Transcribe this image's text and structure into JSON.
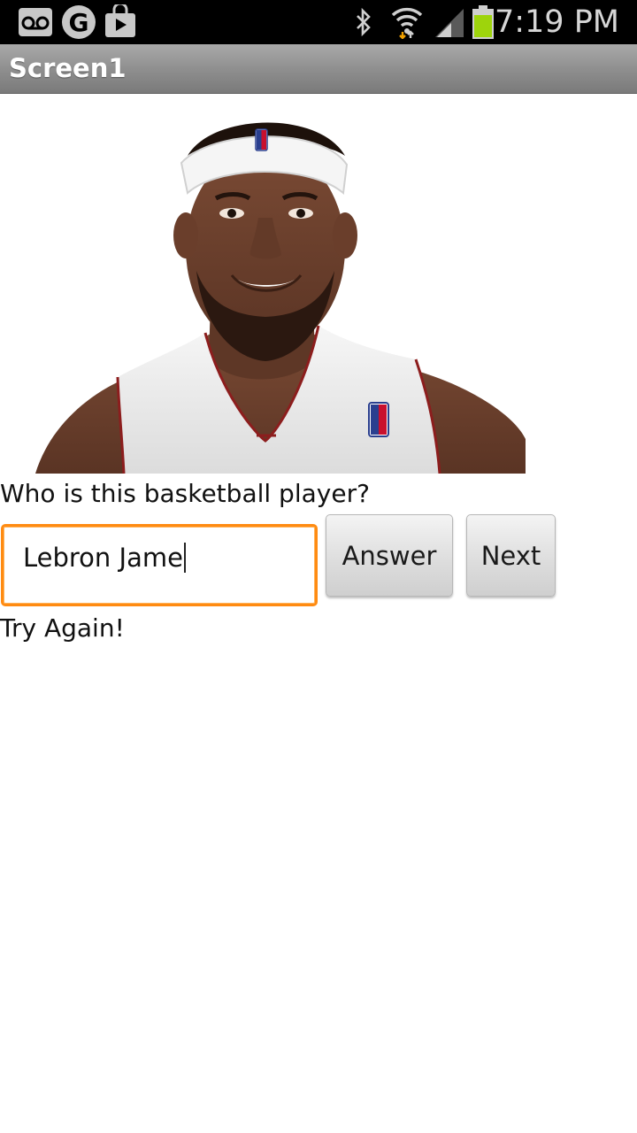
{
  "status_bar": {
    "time": "7:19 PM",
    "icons": [
      "voicemail-icon",
      "google-icon",
      "play-store-icon",
      "bluetooth-icon",
      "wifi-icon",
      "signal-icon",
      "battery-icon"
    ],
    "battery_color": "#9ed40c"
  },
  "app": {
    "title": "Screen1"
  },
  "quiz": {
    "question": "Who is this basketball player?",
    "answer_value": "Lebron Jame",
    "answer_button": "Answer",
    "next_button": "Next",
    "result": "Try Again!"
  },
  "colors": {
    "field_focus": "#ff8b12",
    "title_bar": "#8d8d8d"
  }
}
